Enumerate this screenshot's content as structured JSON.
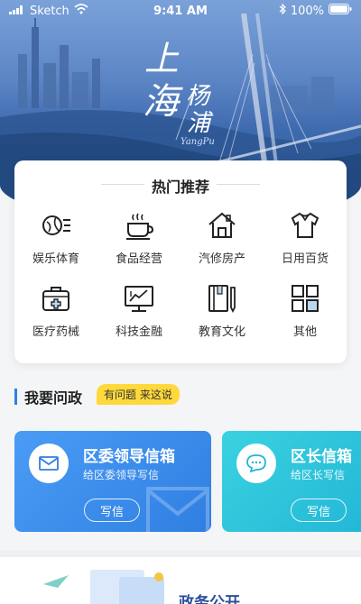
{
  "status_bar": {
    "carrier": "Sketch",
    "time": "9:41 AM",
    "battery": "100%"
  },
  "hero": {
    "title_chars": [
      "上",
      "海",
      "杨",
      "浦"
    ],
    "subtitle": "YangPu"
  },
  "hot": {
    "title": "热门推荐",
    "items": [
      {
        "label": "娱乐体育",
        "icon": "sports-icon"
      },
      {
        "label": "食品经营",
        "icon": "food-icon"
      },
      {
        "label": "汽修房产",
        "icon": "house-icon"
      },
      {
        "label": "日用百货",
        "icon": "shirt-icon"
      },
      {
        "label": "医疗药械",
        "icon": "medical-kit-icon"
      },
      {
        "label": "科技金融",
        "icon": "monitor-chart-icon"
      },
      {
        "label": "教育文化",
        "icon": "book-pencil-icon"
      },
      {
        "label": "其他",
        "icon": "grid-icon"
      }
    ]
  },
  "ask": {
    "title": "我要问政",
    "badge": "有问题 来这说",
    "boxes": [
      {
        "title": "区委领导信箱",
        "subtitle": "给区委领导写信",
        "button": "写信",
        "icon": "mail-icon",
        "color": "#2f7fe2"
      },
      {
        "title": "区长信箱",
        "subtitle": "给区长写信",
        "button": "写信",
        "icon": "chat-icon",
        "color": "#22b6d6"
      }
    ]
  },
  "bottom": {
    "label": "政务公开"
  }
}
